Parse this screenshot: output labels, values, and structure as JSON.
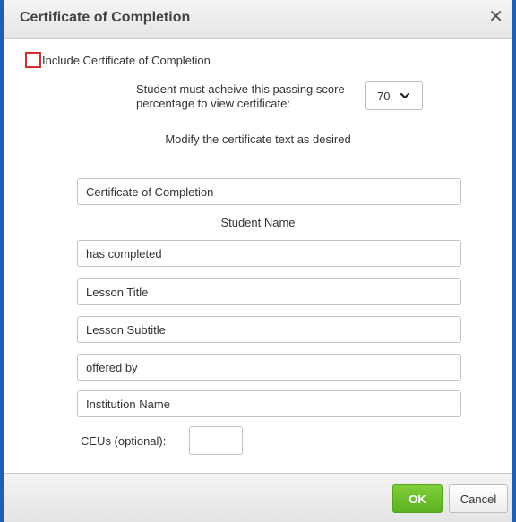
{
  "dialog": {
    "title": "Certificate of Completion",
    "close_icon": "close-icon"
  },
  "include_certificate": {
    "label": "Include Certificate of Completion",
    "checked": false
  },
  "passing_score": {
    "text": "Student must acheive this passing score percentage to view certificate:",
    "value": "70",
    "icon": "chevron-down-icon"
  },
  "modify_text": "Modify the certificate text as desired",
  "fields": {
    "certificate_title": "Certificate of Completion",
    "student_name_label": "Student Name",
    "has_completed": "has completed",
    "lesson_title": "Lesson Title",
    "lesson_subtitle": "Lesson Subtitle",
    "offered_by": "offered by",
    "institution_name": "Institution Name"
  },
  "ceus": {
    "label": "CEUs (optional):",
    "value": ""
  },
  "footer": {
    "ok_label": "OK",
    "cancel_label": "Cancel"
  },
  "colors": {
    "border_accent": "#1f5fb0",
    "ok_green": "#5cb21f",
    "checkbox_red": "#d32f2f"
  }
}
